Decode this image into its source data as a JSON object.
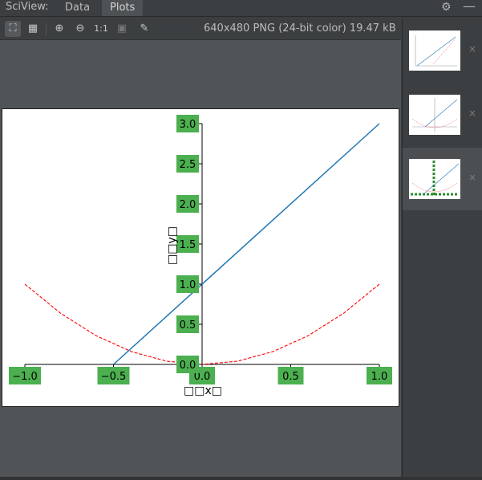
{
  "header": {
    "title": "SciView:",
    "tabs": [
      {
        "label": "Data"
      },
      {
        "label": "Plots"
      }
    ],
    "settings_icon": "gear-icon",
    "hide_icon": "minimize-icon"
  },
  "toolbar": {
    "zoom_to_fit_label": "⛶",
    "grid_label": "▦",
    "zoom_in_label": "⊕",
    "zoom_out_label": "⊖",
    "actual_size_label": "1:1",
    "background_label": "▣",
    "color_picker_label": "✎",
    "image_info": "640x480 PNG (24-bit color) 19.47 kB"
  },
  "thumbnails": [
    {
      "name": "plot-1",
      "close": "×"
    },
    {
      "name": "plot-2",
      "close": "×"
    },
    {
      "name": "plot-3",
      "close": "×",
      "selected": true
    }
  ],
  "chart_data": {
    "type": "line",
    "xlabel": "□□x□",
    "ylabel": "□□y□",
    "xlim": [
      -1.0,
      1.0
    ],
    "ylim": [
      0.0,
      3.0
    ],
    "xticks": [
      "−1.0",
      "−0.5",
      "0.0",
      "0.5",
      "1.0"
    ],
    "yticks": [
      "0.0",
      "0.5",
      "1.0",
      "1.5",
      "2.0",
      "2.5",
      "3.0"
    ],
    "tick_box_color": "#4caf50",
    "series": [
      {
        "style": "solid",
        "color": "#1f77b4",
        "x": [
          -0.5,
          1.0
        ],
        "y": [
          0.0,
          3.0
        ]
      },
      {
        "style": "dashed",
        "color": "#ff0000",
        "x": [
          -1.0,
          -0.8,
          -0.6,
          -0.4,
          -0.2,
          0.0,
          0.2,
          0.4,
          0.6,
          0.8,
          1.0
        ],
        "y": [
          1.0,
          0.64,
          0.36,
          0.16,
          0.04,
          0.0,
          0.04,
          0.16,
          0.36,
          0.64,
          1.0
        ]
      }
    ]
  }
}
